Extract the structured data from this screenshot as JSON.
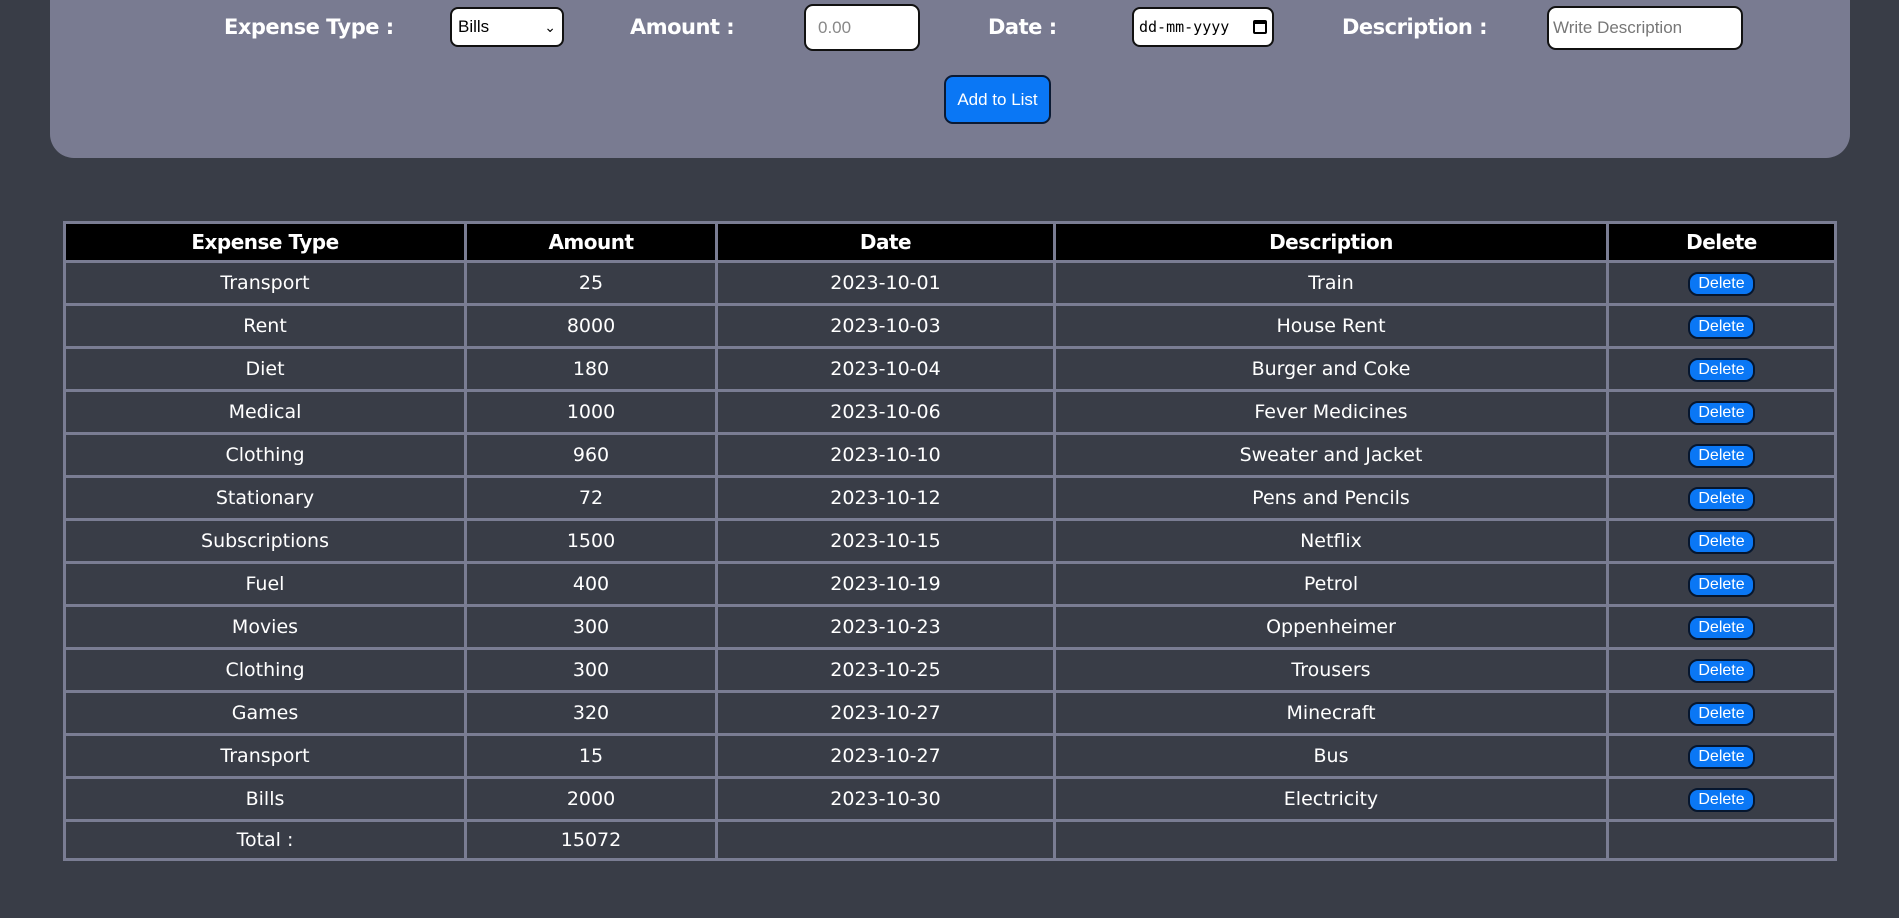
{
  "form": {
    "expense_type_label": "Expense Type :",
    "expense_type_value": "Bills",
    "amount_label": "Amount :",
    "amount_placeholder": "0.00",
    "date_label": "Date :",
    "date_placeholder": "dd-mm-yyyy",
    "description_label": "Description :",
    "description_placeholder": "Write Description",
    "add_button": "Add to List"
  },
  "table": {
    "headers": [
      "Expense Type",
      "Amount",
      "Date",
      "Description",
      "Delete"
    ],
    "delete_label": "Delete",
    "rows": [
      {
        "type": "Transport",
        "amount": "25",
        "date": "2023-10-01",
        "description": "Train"
      },
      {
        "type": "Rent",
        "amount": "8000",
        "date": "2023-10-03",
        "description": "House Rent"
      },
      {
        "type": "Diet",
        "amount": "180",
        "date": "2023-10-04",
        "description": "Burger and Coke"
      },
      {
        "type": "Medical",
        "amount": "1000",
        "date": "2023-10-06",
        "description": "Fever Medicines"
      },
      {
        "type": "Clothing",
        "amount": "960",
        "date": "2023-10-10",
        "description": "Sweater and Jacket"
      },
      {
        "type": "Stationary",
        "amount": "72",
        "date": "2023-10-12",
        "description": "Pens and Pencils"
      },
      {
        "type": "Subscriptions",
        "amount": "1500",
        "date": "2023-10-15",
        "description": "Netflix"
      },
      {
        "type": "Fuel",
        "amount": "400",
        "date": "2023-10-19",
        "description": "Petrol"
      },
      {
        "type": "Movies",
        "amount": "300",
        "date": "2023-10-23",
        "description": "Oppenheimer"
      },
      {
        "type": "Clothing",
        "amount": "300",
        "date": "2023-10-25",
        "description": "Trousers"
      },
      {
        "type": "Games",
        "amount": "320",
        "date": "2023-10-27",
        "description": "Minecraft"
      },
      {
        "type": "Transport",
        "amount": "15",
        "date": "2023-10-27",
        "description": "Bus"
      },
      {
        "type": "Bills",
        "amount": "2000",
        "date": "2023-10-30",
        "description": "Electricity"
      }
    ],
    "total_label": "Total :",
    "total_value": "15072"
  },
  "colors": {
    "background": "#393d47",
    "panel": "#797b91",
    "accent": "#0a77f5",
    "header_bg": "#000000"
  }
}
